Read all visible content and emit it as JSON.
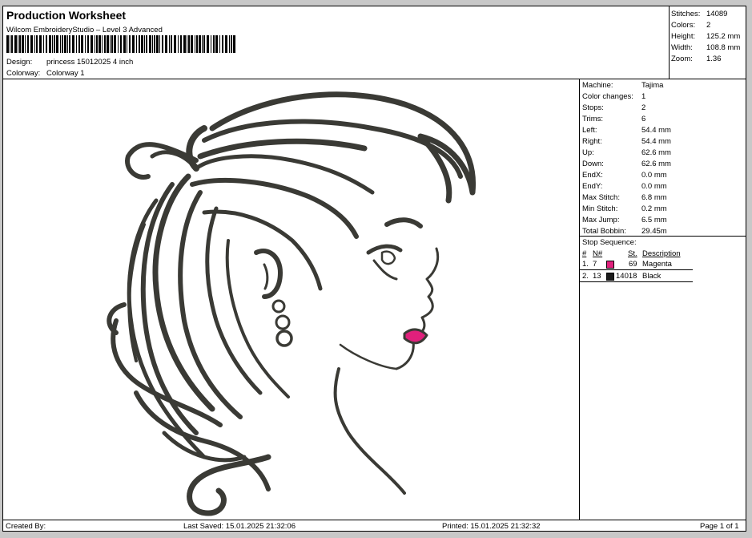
{
  "header": {
    "title": "Production Worksheet",
    "software": "Wilcom EmbroideryStudio – Level 3 Advanced",
    "design_label": "Design:",
    "design_value": "princess 15012025 4 inch",
    "colorway_label": "Colorway:",
    "colorway_value": "Colorway 1"
  },
  "summary": [
    {
      "label": "Stitches:",
      "value": "14089"
    },
    {
      "label": "Colors:",
      "value": "2"
    },
    {
      "label": "Height:",
      "value": "125.2 mm"
    },
    {
      "label": "Width:",
      "value": "108.8 mm"
    },
    {
      "label": "Zoom:",
      "value": "1.36"
    }
  ],
  "machine_info": [
    {
      "label": "Machine:",
      "value": "Tajima"
    },
    {
      "label": "Color changes:",
      "value": "1"
    },
    {
      "label": "Stops:",
      "value": "2"
    },
    {
      "label": "Trims:",
      "value": "6"
    },
    {
      "label": "Left:",
      "value": "54.4 mm"
    },
    {
      "label": "Right:",
      "value": "54.4 mm"
    },
    {
      "label": "Up:",
      "value": "62.6 mm"
    },
    {
      "label": "Down:",
      "value": "62.6 mm"
    },
    {
      "label": "EndX:",
      "value": "0.0 mm"
    },
    {
      "label": "EndY:",
      "value": "0.0 mm"
    },
    {
      "label": "Max Stitch:",
      "value": "6.8 mm"
    },
    {
      "label": "Min Stitch:",
      "value": "0.2 mm"
    },
    {
      "label": "Max Jump:",
      "value": "6.5 mm"
    },
    {
      "label": "Total Bobbin:",
      "value": "29.45m"
    }
  ],
  "stop_sequence": {
    "title": "Stop Sequence:",
    "headers": {
      "num": "#",
      "n": "N#",
      "st": "St.",
      "desc": "Description"
    },
    "rows": [
      {
        "num": "1.",
        "n": "7",
        "color": "#e0207c",
        "st": "69",
        "desc": "Magenta"
      },
      {
        "num": "2.",
        "n": "13",
        "color": "#1a1a1a",
        "st": "14018",
        "desc": "Black"
      }
    ]
  },
  "footer": {
    "created_by": "Created By:",
    "last_saved": "Last Saved: 15.01.2025 21:32:06",
    "printed": "Printed: 15.01.2025 21:32:32",
    "page": "Page 1 of 1"
  },
  "colors": {
    "thread_dark": "#3a3a35",
    "thread_pink": "#e0207c"
  }
}
